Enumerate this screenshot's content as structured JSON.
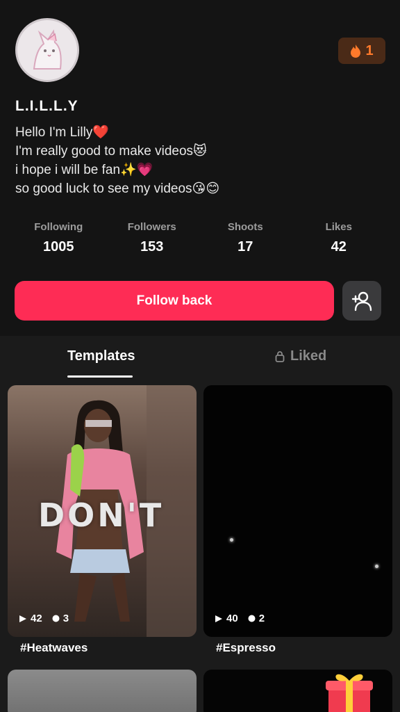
{
  "profile": {
    "username": "L.I.L.L.Y",
    "streak_count": "1",
    "bio": [
      "Hello I'm Lilly❤️",
      "I'm really good to make videos😻",
      "i hope i will be fan✨💗",
      "so good luck to see my videos😘😊"
    ]
  },
  "stats": [
    {
      "label": "Following",
      "value": "1005"
    },
    {
      "label": "Followers",
      "value": "153"
    },
    {
      "label": "Shoots",
      "value": "17"
    },
    {
      "label": "Likes",
      "value": "42"
    }
  ],
  "actions": {
    "follow_label": "Follow back"
  },
  "tabs": [
    {
      "label": "Templates",
      "active": true
    },
    {
      "label": "Liked",
      "locked": true
    }
  ],
  "templates": [
    {
      "title": "#Heatwaves",
      "plays": "42",
      "uses": "3",
      "overlay_text": "DON'T"
    },
    {
      "title": "#Espresso",
      "plays": "40",
      "uses": "2"
    }
  ],
  "colors": {
    "accent": "#fe2c55",
    "streak": "#ff7a2b",
    "background": "#141414"
  }
}
